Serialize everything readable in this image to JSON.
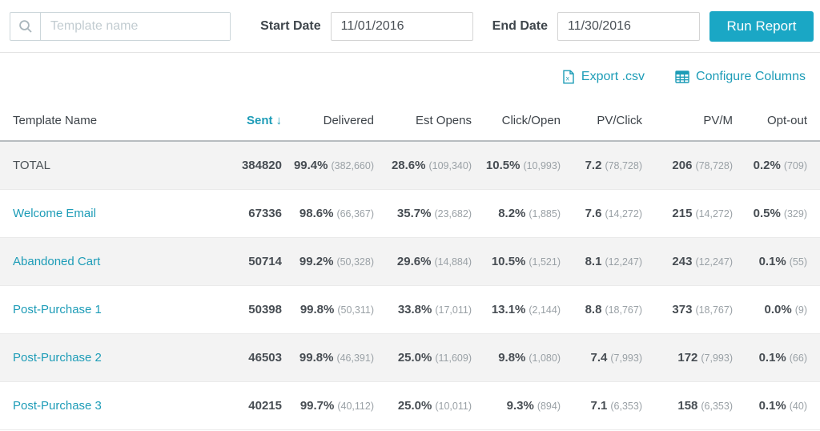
{
  "colors": {
    "accent_link": "#1d9cb7",
    "accent_button": "#1aa7c5",
    "row_shade": "#f3f3f3"
  },
  "toolbar": {
    "search_placeholder": "Template name",
    "start_date_label": "Start Date",
    "start_date_value": "11/01/2016",
    "end_date_label": "End Date",
    "end_date_value": "11/30/2016",
    "run_report_label": "Run Report"
  },
  "actions": {
    "export_csv_label": "Export .csv",
    "configure_columns_label": "Configure Columns"
  },
  "table": {
    "columns": [
      "Template Name",
      "Sent",
      "Delivered",
      "Est Opens",
      "Click/Open",
      "PV/Click",
      "PV/M",
      "Opt-out"
    ],
    "sort": {
      "column": "Sent",
      "direction": "desc",
      "arrow": "↓"
    },
    "rows": [
      {
        "name": "TOTAL",
        "is_total": true,
        "sent": "384820",
        "delivered": {
          "value": "99.4%",
          "sub": "(382,660)"
        },
        "est_opens": {
          "value": "28.6%",
          "sub": "(109,340)"
        },
        "click_open": {
          "value": "10.5%",
          "sub": "(10,993)"
        },
        "pv_click": {
          "value": "7.2",
          "sub": "(78,728)"
        },
        "pv_m": {
          "value": "206",
          "sub": "(78,728)"
        },
        "opt_out": {
          "value": "0.2%",
          "sub": "(709)"
        }
      },
      {
        "name": "Welcome Email",
        "is_total": false,
        "sent": "67336",
        "delivered": {
          "value": "98.6%",
          "sub": "(66,367)"
        },
        "est_opens": {
          "value": "35.7%",
          "sub": "(23,682)"
        },
        "click_open": {
          "value": "8.2%",
          "sub": "(1,885)"
        },
        "pv_click": {
          "value": "7.6",
          "sub": "(14,272)"
        },
        "pv_m": {
          "value": "215",
          "sub": "(14,272)"
        },
        "opt_out": {
          "value": "0.5%",
          "sub": "(329)"
        }
      },
      {
        "name": "Abandoned Cart",
        "is_total": false,
        "sent": "50714",
        "delivered": {
          "value": "99.2%",
          "sub": "(50,328)"
        },
        "est_opens": {
          "value": "29.6%",
          "sub": "(14,884)"
        },
        "click_open": {
          "value": "10.5%",
          "sub": "(1,521)"
        },
        "pv_click": {
          "value": "8.1",
          "sub": "(12,247)"
        },
        "pv_m": {
          "value": "243",
          "sub": "(12,247)"
        },
        "opt_out": {
          "value": "0.1%",
          "sub": "(55)"
        }
      },
      {
        "name": "Post-Purchase 1",
        "is_total": false,
        "sent": "50398",
        "delivered": {
          "value": "99.8%",
          "sub": "(50,311)"
        },
        "est_opens": {
          "value": "33.8%",
          "sub": "(17,011)"
        },
        "click_open": {
          "value": "13.1%",
          "sub": "(2,144)"
        },
        "pv_click": {
          "value": "8.8",
          "sub": "(18,767)"
        },
        "pv_m": {
          "value": "373",
          "sub": "(18,767)"
        },
        "opt_out": {
          "value": "0.0%",
          "sub": "(9)"
        }
      },
      {
        "name": "Post-Purchase 2",
        "is_total": false,
        "sent": "46503",
        "delivered": {
          "value": "99.8%",
          "sub": "(46,391)"
        },
        "est_opens": {
          "value": "25.0%",
          "sub": "(11,609)"
        },
        "click_open": {
          "value": "9.8%",
          "sub": "(1,080)"
        },
        "pv_click": {
          "value": "7.4",
          "sub": "(7,993)"
        },
        "pv_m": {
          "value": "172",
          "sub": "(7,993)"
        },
        "opt_out": {
          "value": "0.1%",
          "sub": "(66)"
        }
      },
      {
        "name": "Post-Purchase 3",
        "is_total": false,
        "sent": "40215",
        "delivered": {
          "value": "99.7%",
          "sub": "(40,112)"
        },
        "est_opens": {
          "value": "25.0%",
          "sub": "(10,011)"
        },
        "click_open": {
          "value": "9.3%",
          "sub": "(894)"
        },
        "pv_click": {
          "value": "7.1",
          "sub": "(6,353)"
        },
        "pv_m": {
          "value": "158",
          "sub": "(6,353)"
        },
        "opt_out": {
          "value": "0.1%",
          "sub": "(40)"
        }
      }
    ]
  }
}
